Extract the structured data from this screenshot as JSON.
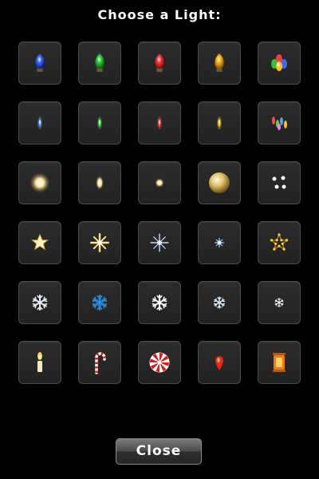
{
  "dialog": {
    "title": "Choose a Light:",
    "close_label": "Close"
  },
  "lights": [
    {
      "name": "blue-bulb-icon"
    },
    {
      "name": "green-bulb-icon"
    },
    {
      "name": "red-bulb-icon"
    },
    {
      "name": "yellow-bulb-icon"
    },
    {
      "name": "multicolor-bulbs-icon"
    },
    {
      "name": "blue-mini-light-icon"
    },
    {
      "name": "green-mini-light-icon"
    },
    {
      "name": "red-mini-light-icon"
    },
    {
      "name": "yellow-mini-light-icon"
    },
    {
      "name": "multicolor-mini-lights-icon"
    },
    {
      "name": "warm-glow-large-icon"
    },
    {
      "name": "warm-glow-oval-icon"
    },
    {
      "name": "warm-dot-icon"
    },
    {
      "name": "gold-orb-icon"
    },
    {
      "name": "dot-cluster-icon"
    },
    {
      "name": "gold-star-icon"
    },
    {
      "name": "gold-sparkle-icon"
    },
    {
      "name": "blue-sparkle-icon"
    },
    {
      "name": "blue-mini-sparkle-icon"
    },
    {
      "name": "star-outline-lights-icon"
    },
    {
      "name": "snowflake-white-icon"
    },
    {
      "name": "snowflake-blue-icon"
    },
    {
      "name": "snowflake-crystal-icon"
    },
    {
      "name": "snowflake-small-icon"
    },
    {
      "name": "snowflake-tiny-icon"
    },
    {
      "name": "candle-icon"
    },
    {
      "name": "candy-cane-icon"
    },
    {
      "name": "peppermint-candy-icon"
    },
    {
      "name": "red-pin-light-icon"
    },
    {
      "name": "lantern-icon"
    }
  ]
}
